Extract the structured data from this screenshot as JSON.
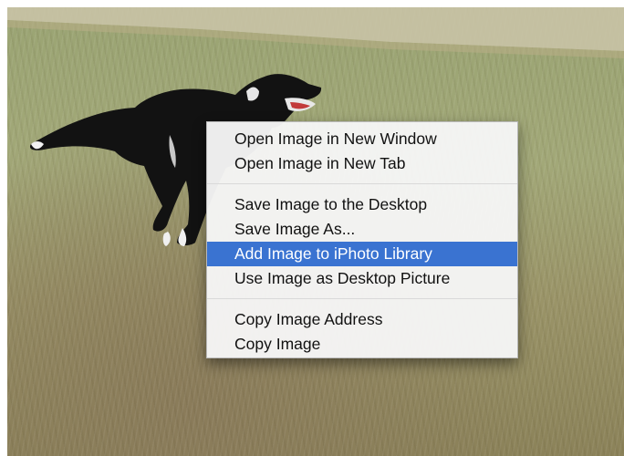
{
  "context_menu": {
    "groups": [
      {
        "items": [
          "Open Image in New Window",
          "Open Image in New Tab"
        ]
      },
      {
        "items": [
          "Save Image to the Desktop",
          "Save Image As...",
          "Add Image to iPhoto Library",
          "Use Image as Desktop Picture"
        ]
      },
      {
        "items": [
          "Copy Image Address",
          "Copy Image"
        ]
      }
    ],
    "highlighted_item": "Add Image to iPhoto Library",
    "highlight_color": "#3a73d1"
  },
  "photo": {
    "icons": [
      "dog-photo",
      "grass-field"
    ]
  }
}
